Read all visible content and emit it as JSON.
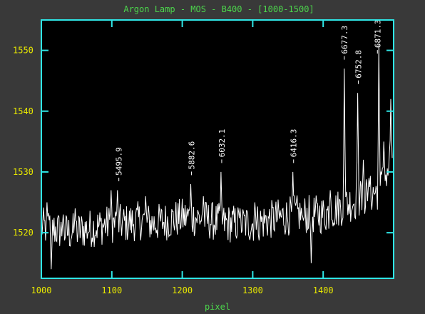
{
  "chart_data": {
    "type": "line",
    "title": "Argon Lamp - MOS - B400 - [1000-1500]",
    "xlabel": "pixel",
    "ylabel": "",
    "xlim": [
      1000,
      1500
    ],
    "ylim": [
      1512.5,
      1555
    ],
    "x_ticks": [
      {
        "value": 1000,
        "label": "1000"
      },
      {
        "value": 1100,
        "label": "1100"
      },
      {
        "value": 1200,
        "label": "1200"
      },
      {
        "value": 1300,
        "label": "1300"
      },
      {
        "value": 1400,
        "label": "1400"
      }
    ],
    "y_ticks": [
      {
        "value": 1520,
        "label": "1520"
      },
      {
        "value": 1530,
        "label": "1530"
      },
      {
        "value": 1540,
        "label": "1540"
      },
      {
        "value": 1550,
        "label": "1550"
      }
    ],
    "series": [
      {
        "baseline_points": [
          [
            1000,
            1521
          ],
          [
            1020,
            1520.5
          ],
          [
            1040,
            1520
          ],
          [
            1060,
            1520.5
          ],
          [
            1080,
            1521
          ],
          [
            1100,
            1521.5
          ],
          [
            1120,
            1521.5
          ],
          [
            1140,
            1522
          ],
          [
            1160,
            1521.5
          ],
          [
            1180,
            1522
          ],
          [
            1200,
            1522.5
          ],
          [
            1220,
            1522.5
          ],
          [
            1240,
            1522
          ],
          [
            1260,
            1521.5
          ],
          [
            1280,
            1521.5
          ],
          [
            1300,
            1521.5
          ],
          [
            1320,
            1522
          ],
          [
            1340,
            1522.5
          ],
          [
            1360,
            1523
          ],
          [
            1380,
            1523
          ],
          [
            1400,
            1523
          ],
          [
            1420,
            1524
          ],
          [
            1440,
            1525
          ],
          [
            1460,
            1526
          ],
          [
            1480,
            1527
          ],
          [
            1500,
            1533
          ]
        ],
        "peaks": [
          [
            1008,
            1525
          ],
          [
            1014,
            1514
          ],
          [
            1031,
            1523
          ],
          [
            1048,
            1524
          ],
          [
            1099,
            1527
          ],
          [
            1108,
            1527
          ],
          [
            1148,
            1526
          ],
          [
            1212,
            1528
          ],
          [
            1230,
            1526
          ],
          [
            1255,
            1530
          ],
          [
            1282,
            1524
          ],
          [
            1303,
            1525
          ],
          [
            1357,
            1530
          ],
          [
            1372,
            1522
          ],
          [
            1383,
            1515
          ],
          [
            1410,
            1527
          ],
          [
            1430,
            1547
          ],
          [
            1449,
            1543
          ],
          [
            1457,
            1532
          ],
          [
            1465,
            1529
          ],
          [
            1479,
            1551
          ],
          [
            1486,
            1535
          ],
          [
            1496,
            1542
          ]
        ]
      }
    ],
    "annotations": [
      {
        "label": "5495.9",
        "x": 1110,
        "y": 1528
      },
      {
        "label": "5882.6",
        "x": 1213,
        "y": 1529
      },
      {
        "label": "6032.1",
        "x": 1256,
        "y": 1531
      },
      {
        "label": "6416.3",
        "x": 1358,
        "y": 1531
      },
      {
        "label": "6677.3",
        "x": 1430,
        "y": 1548
      },
      {
        "label": "6752.8",
        "x": 1450,
        "y": 1544
      },
      {
        "label": "6871.3",
        "x": 1477,
        "y": 1549
      }
    ],
    "grid": false,
    "colors": {
      "background": "#393939",
      "plot_area": "#000000",
      "frame": "#2fe6e6",
      "line": "#ffffff",
      "title": "#4cd64c",
      "tick_labels": "#e8e800"
    }
  }
}
